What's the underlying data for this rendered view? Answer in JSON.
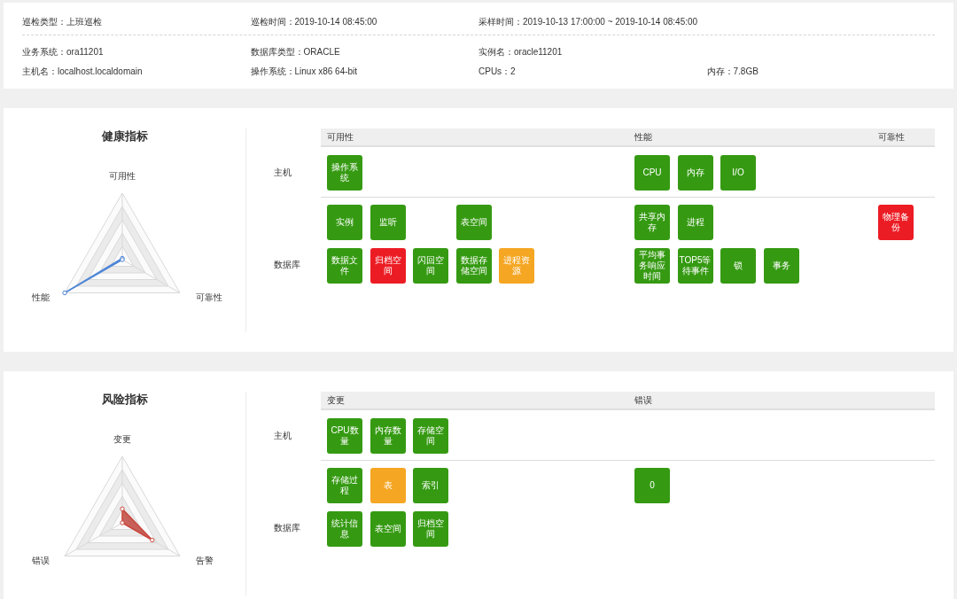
{
  "info": {
    "sections": [
      {
        "rows": [
          [
            "巡检类型：上班巡检",
            "巡检时间：2019-10-14 08:45:00",
            "采样时间：2019-10-13 17:00:00 ~ 2019-10-14 08:45:00"
          ]
        ]
      },
      {
        "rows": [
          [
            "业务系统：ora11201",
            "数据库类型：ORACLE",
            "实例名：oracle11201"
          ],
          [
            "主机名：localhost.localdomain",
            "操作系统：Linux x86 64-bit",
            "CPUs：2",
            "内存：7.8GB"
          ]
        ]
      }
    ]
  },
  "panels": [
    {
      "title": "健康指标",
      "radar": {
        "axes": [
          "可用性",
          "性能",
          "可靠性"
        ]
      },
      "table": {
        "columns": [
          "可用性",
          "性能",
          "可靠性"
        ],
        "rows": [
          {
            "label": "主机",
            "cells": [
              {
                "lines": [
                  [
                    {
                      "kind": "tile",
                      "text": "操作系统",
                      "color": "#359a12"
                    }
                  ]
                ]
              },
              {
                "lines": [
                  [
                    {
                      "kind": "tile",
                      "text": "CPU",
                      "color": "#359a12"
                    },
                    {
                      "kind": "tile",
                      "text": "内存",
                      "color": "#359a12"
                    },
                    {
                      "kind": "tile",
                      "text": "I/O",
                      "color": "#359a12"
                    }
                  ]
                ]
              },
              {}
            ]
          },
          {
            "label": "数据库",
            "cells": [
              {
                "lines": [
                  [
                    {
                      "kind": "tile",
                      "text": "实例",
                      "color": "#359a12"
                    },
                    {
                      "kind": "tile",
                      "text": "监听",
                      "color": "#359a12"
                    },
                    {
                      "kind": "blank"
                    },
                    {
                      "kind": "tile",
                      "text": "表空间",
                      "color": "#359a12"
                    }
                  ],
                  [
                    {
                      "kind": "tile",
                      "text": "数据文件",
                      "color": "#359a12"
                    },
                    {
                      "kind": "tile",
                      "text": "归档空间",
                      "color": "#ec1c24"
                    },
                    {
                      "kind": "tile",
                      "text": "闪回空间",
                      "color": "#359a12"
                    },
                    {
                      "kind": "tile",
                      "text": "数据存储空间",
                      "color": "#359a12"
                    },
                    {
                      "kind": "tile",
                      "text": "进程资源",
                      "color": "#f5a623"
                    }
                  ]
                ]
              },
              {
                "lines": [
                  [
                    {
                      "kind": "tile",
                      "text": "共享内存",
                      "color": "#359a12"
                    },
                    {
                      "kind": "tile",
                      "text": "进程",
                      "color": "#359a12"
                    }
                  ],
                  [
                    {
                      "kind": "tile",
                      "text": "平均事务响应时间",
                      "color": "#359a12"
                    },
                    {
                      "kind": "tile",
                      "text": "TOP5等待事件",
                      "color": "#359a12"
                    },
                    {
                      "kind": "tile",
                      "text": "锁",
                      "color": "#359a12"
                    },
                    {
                      "kind": "tile",
                      "text": "事务",
                      "color": "#359a12"
                    }
                  ]
                ]
              },
              {
                "lines": [
                  [
                    {
                      "kind": "tile",
                      "text": "物理备份",
                      "color": "#ec1c24"
                    }
                  ]
                ]
              }
            ]
          }
        ]
      }
    },
    {
      "title": "风险指标",
      "radar": {
        "axes": [
          "变更",
          "错误",
          "告警"
        ]
      },
      "table": {
        "columns": [
          "变更",
          "错误"
        ],
        "rows": [
          {
            "label": "主机",
            "cells": [
              {
                "lines": [
                  [
                    {
                      "kind": "tile",
                      "text": "CPU数量",
                      "color": "#359a12"
                    },
                    {
                      "kind": "tile",
                      "text": "内存数量",
                      "color": "#359a12"
                    },
                    {
                      "kind": "tile",
                      "text": "存储空间",
                      "color": "#359a12"
                    }
                  ]
                ]
              },
              {}
            ]
          },
          {
            "label": "数据库",
            "cells": [
              {
                "lines": [
                  [
                    {
                      "kind": "tile",
                      "text": "存储过程",
                      "color": "#359a12"
                    },
                    {
                      "kind": "tile",
                      "text": "表",
                      "color": "#f5a623"
                    },
                    {
                      "kind": "tile",
                      "text": "索引",
                      "color": "#359a12"
                    }
                  ],
                  [
                    {
                      "kind": "tile",
                      "text": "统计信息",
                      "color": "#359a12"
                    },
                    {
                      "kind": "tile",
                      "text": "表空间",
                      "color": "#359a12"
                    },
                    {
                      "kind": "tile",
                      "text": "归档空间",
                      "color": "#359a12"
                    }
                  ]
                ]
              },
              {
                "lines": [
                  [
                    {
                      "kind": "tile",
                      "text": "0",
                      "color": "#359a12"
                    }
                  ]
                ]
              }
            ]
          }
        ]
      }
    }
  ]
}
